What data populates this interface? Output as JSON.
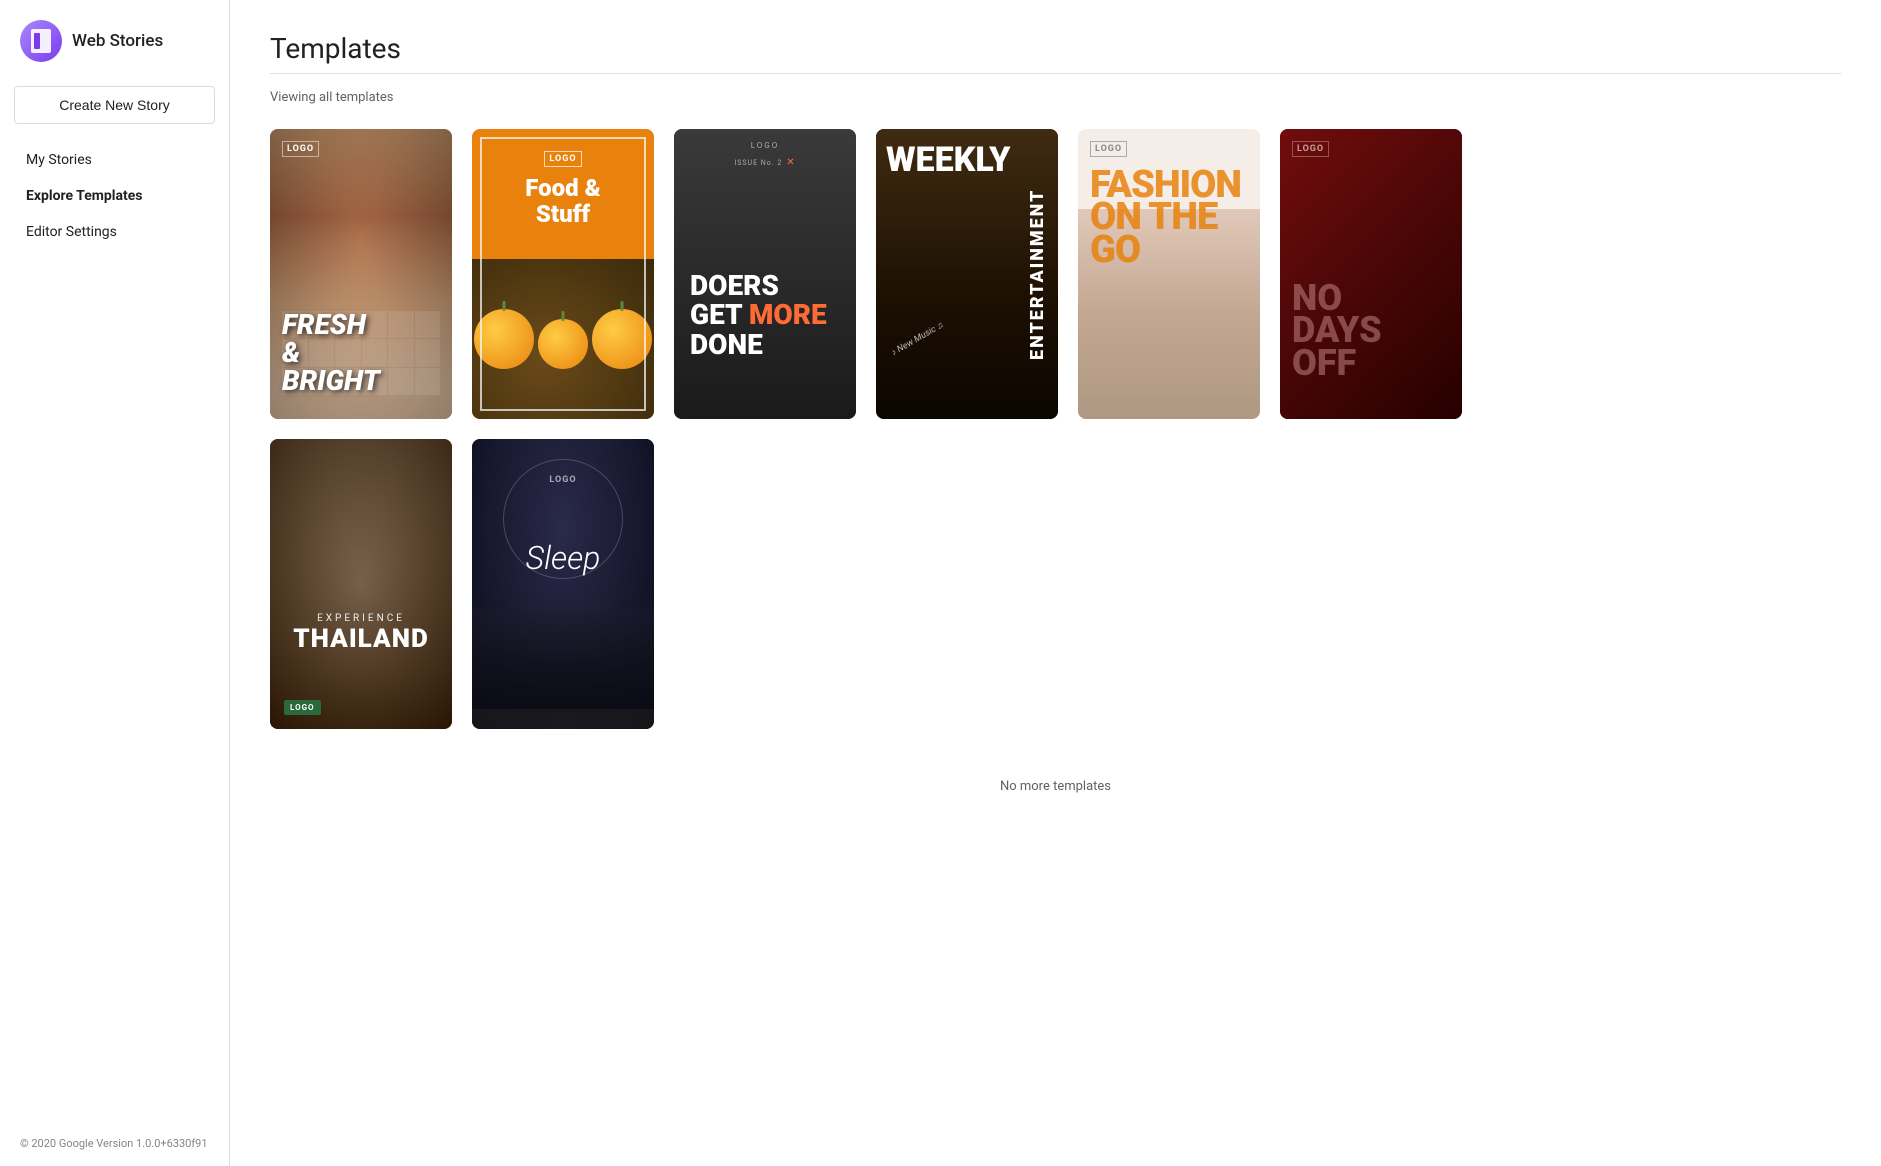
{
  "app": {
    "name": "Web Stories"
  },
  "sidebar": {
    "create_button": "Create New Story",
    "nav_items": [
      {
        "id": "my-stories",
        "label": "My Stories",
        "active": false
      },
      {
        "id": "explore-templates",
        "label": "Explore Templates",
        "active": true
      },
      {
        "id": "editor-settings",
        "label": "Editor Settings",
        "active": false
      }
    ],
    "footer": "© 2020 Google Version 1.0.0+6330f91"
  },
  "main": {
    "title": "Templates",
    "viewing_label": "Viewing all templates",
    "no_more_label": "No more templates"
  },
  "templates": [
    {
      "id": "fresh-bright",
      "logo": "LOGO",
      "title": "FRESH\n&\nBRIGHT",
      "style": "t1"
    },
    {
      "id": "food-stuff",
      "logo": "LOGO",
      "title": "Food &\nStuff",
      "style": "t2"
    },
    {
      "id": "doers",
      "logo": "LOGO",
      "issue": "ISSUE No. 2",
      "title": "DOERS\nGET MORE\nDONE",
      "style": "t3"
    },
    {
      "id": "weekly-entertainment",
      "weekly": "WEEKLY",
      "entertainment": "ENTERTAINMENT",
      "music": "New Music",
      "style": "t4"
    },
    {
      "id": "fashion-go",
      "logo": "LOGO",
      "title": "FASHION\nON THE\nGO",
      "style": "t5"
    },
    {
      "id": "no-days-off",
      "logo": "LOGO",
      "title": "NO\nDAYS\nOFF",
      "style": "t6"
    },
    {
      "id": "thailand",
      "experience": "EXPERIENCE",
      "title": "THAILAND",
      "logo": "LOGO",
      "style": "t7"
    },
    {
      "id": "sleep",
      "logo": "LOGO",
      "title": "Sleep",
      "style": "t8"
    }
  ]
}
